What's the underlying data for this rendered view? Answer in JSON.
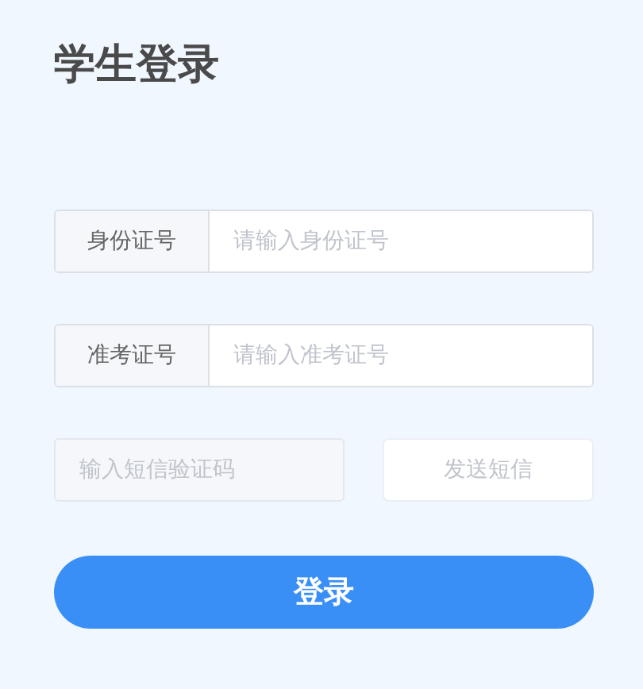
{
  "title": "学生登录",
  "fields": [
    {
      "label": "身份证号",
      "placeholder": "请输入身份证号"
    },
    {
      "label": "准考证号",
      "placeholder": "请输入准考证号"
    }
  ],
  "sms": {
    "placeholder": "输入短信验证码",
    "disabled": true,
    "button": {
      "label": "发送短信",
      "disabled": true
    }
  },
  "submit": {
    "label": "登录"
  }
}
